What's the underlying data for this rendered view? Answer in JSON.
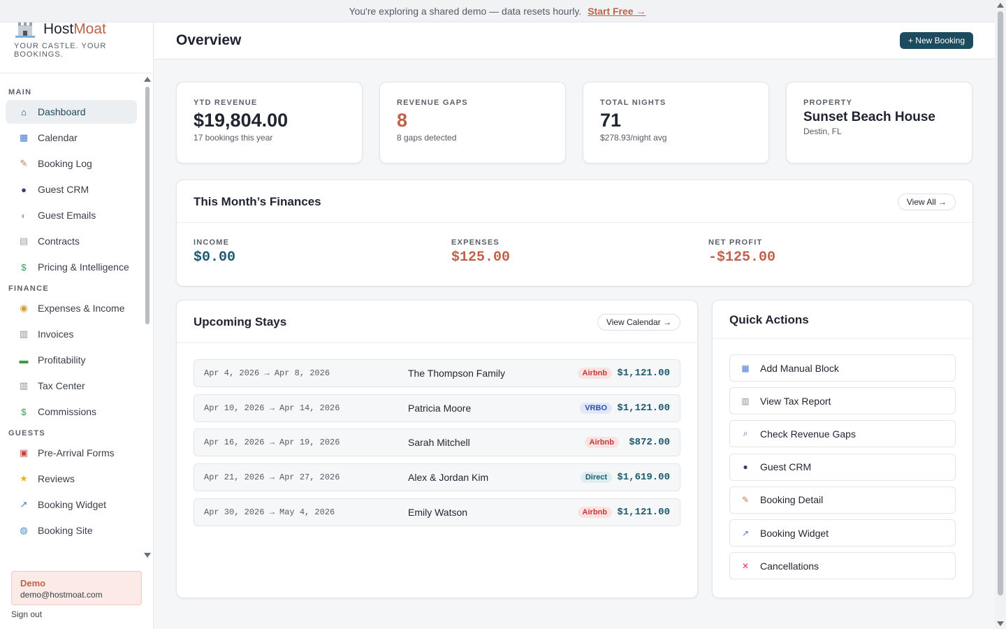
{
  "banner": {
    "text": "You're exploring a shared demo — data resets hourly.",
    "link": "Start Free →"
  },
  "brand": {
    "name_a": "Host",
    "name_b": "Moat",
    "tagline": "YOUR CASTLE. YOUR BOOKINGS."
  },
  "sidebar": {
    "sections": [
      {
        "title": "MAIN",
        "items": [
          {
            "label": "Dashboard",
            "icon": "home-icon",
            "active": true
          },
          {
            "label": "Calendar",
            "icon": "calendar-icon"
          },
          {
            "label": "Booking Log",
            "icon": "memo-icon"
          },
          {
            "label": "Guest CRM",
            "icon": "person-icon"
          },
          {
            "label": "Guest Emails",
            "icon": "speech-bubble-icon"
          },
          {
            "label": "Contracts",
            "icon": "document-icon"
          },
          {
            "label": "Pricing & Intelligence",
            "icon": "dollar-icon"
          }
        ]
      },
      {
        "title": "FINANCE",
        "items": [
          {
            "label": "Expenses & Income",
            "icon": "money-bag-icon"
          },
          {
            "label": "Invoices",
            "icon": "receipt-icon"
          },
          {
            "label": "Profitability",
            "icon": "banknote-icon"
          },
          {
            "label": "Tax Center",
            "icon": "receipt-icon"
          },
          {
            "label": "Commissions",
            "icon": "dollar-icon"
          }
        ]
      },
      {
        "title": "GUESTS",
        "items": [
          {
            "label": "Pre-Arrival Forms",
            "icon": "clipboard-icon"
          },
          {
            "label": "Reviews",
            "icon": "star-icon"
          },
          {
            "label": "Booking Widget",
            "icon": "chart-icon"
          },
          {
            "label": "Booking Site",
            "icon": "globe-icon"
          }
        ]
      }
    ],
    "user": {
      "role": "Demo",
      "email": "demo@hostmoat.com",
      "signout": "Sign out"
    }
  },
  "header": {
    "title": "Overview",
    "new_booking": "+ New Booking"
  },
  "stats": {
    "ytd": {
      "label": "YTD REVENUE",
      "value": "$19,804.00",
      "sub": "17 bookings this year"
    },
    "gaps": {
      "label": "REVENUE GAPS",
      "value": "8",
      "sub": "8 gaps detected"
    },
    "nights": {
      "label": "TOTAL NIGHTS",
      "value": "71",
      "sub": "$278.93/night avg"
    },
    "property": {
      "label": "PROPERTY",
      "value": "Sunset Beach House",
      "sub": "Destin, FL"
    }
  },
  "finances": {
    "title": "This Month’s Finances",
    "view_all": "View All →",
    "income": {
      "label": "INCOME",
      "value": "$0.00",
      "color": "#1c5a6e"
    },
    "expenses": {
      "label": "EXPENSES",
      "value": "$125.00",
      "color": "#c0614b"
    },
    "net": {
      "label": "NET PROFIT",
      "value": "-$125.00",
      "color": "#c0614b"
    }
  },
  "upcoming": {
    "title": "Upcoming Stays",
    "view_calendar": "View Calendar →",
    "rows": [
      {
        "dates": "Apr 4, 2026 → Apr 8, 2026",
        "guest": "The Thompson Family",
        "source": "Airbnb",
        "amount": "$1,121.00"
      },
      {
        "dates": "Apr 10, 2026 → Apr 14, 2026",
        "guest": "Patricia Moore",
        "source": "VRBO",
        "amount": "$1,121.00"
      },
      {
        "dates": "Apr 16, 2026 → Apr 19, 2026",
        "guest": "Sarah Mitchell",
        "source": "Airbnb",
        "amount": "$872.00"
      },
      {
        "dates": "Apr 21, 2026 → Apr 27, 2026",
        "guest": "Alex & Jordan Kim",
        "source": "Direct",
        "amount": "$1,619.00"
      },
      {
        "dates": "Apr 30, 2026 → May 4, 2026",
        "guest": "Emily Watson",
        "source": "Airbnb",
        "amount": "$1,121.00"
      }
    ]
  },
  "quick_actions": {
    "title": "Quick Actions",
    "items": [
      {
        "label": "Add Manual Block",
        "icon": "calendar-icon"
      },
      {
        "label": "View Tax Report",
        "icon": "receipt-icon"
      },
      {
        "label": "Check Revenue Gaps",
        "icon": "magnifier-icon"
      },
      {
        "label": "Guest CRM",
        "icon": "person-icon"
      },
      {
        "label": "Booking Detail",
        "icon": "memo-icon"
      },
      {
        "label": "Booking Widget",
        "icon": "chart-icon"
      },
      {
        "label": "Cancellations",
        "icon": "cross-icon"
      }
    ]
  }
}
